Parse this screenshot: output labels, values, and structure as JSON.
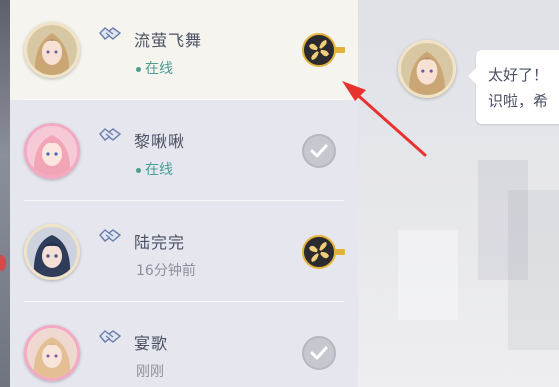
{
  "friends": [
    {
      "name": "流萤飞舞",
      "status": "在线",
      "online": true,
      "action": "gift-icon"
    },
    {
      "name": "黎啾啾",
      "status": "在线",
      "online": true,
      "action": "check-icon"
    },
    {
      "name": "陆完完",
      "status": "16分钟前",
      "online": false,
      "action": "gift-icon"
    },
    {
      "name": "宴歌",
      "status": "刚刚",
      "online": false,
      "action": "check-icon"
    }
  ],
  "chat": {
    "line1": "太好了！",
    "line2": "识啦，希"
  },
  "colors": {
    "online": "#4a9d90",
    "name": "#4a5063",
    "gift_ring": "#e2b23b",
    "annotation_arrow": "#e8322d"
  },
  "icons": [
    "friend-handshake-icon",
    "gift-icon",
    "check-icon",
    "annotation-arrow"
  ]
}
